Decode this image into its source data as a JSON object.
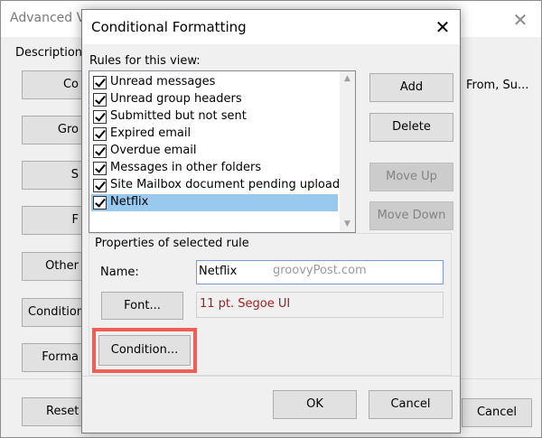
{
  "background_dialog": {
    "title": "Advanced V",
    "description_label": "Description",
    "buttons": [
      "Co",
      "Gro",
      "S",
      "F",
      "Other",
      "Condition",
      "Forma"
    ],
    "from_text": "From, Su...",
    "reset_label": "Reset C",
    "cancel_label": "Cancel",
    "close_glyph": "✕"
  },
  "dialog": {
    "title": "Conditional Formatting",
    "close_glyph": "✕",
    "rules_label": "Rules for this view:",
    "rules": [
      {
        "label": "Unread messages",
        "checked": true,
        "selected": false
      },
      {
        "label": "Unread group headers",
        "checked": true,
        "selected": false
      },
      {
        "label": "Submitted but not sent",
        "checked": true,
        "selected": false
      },
      {
        "label": "Expired email",
        "checked": true,
        "selected": false
      },
      {
        "label": "Overdue email",
        "checked": true,
        "selected": false
      },
      {
        "label": "Messages in other folders",
        "checked": true,
        "selected": false
      },
      {
        "label": "Site Mailbox document pending upload",
        "checked": true,
        "selected": false
      },
      {
        "label": "Netflix",
        "checked": true,
        "selected": true
      }
    ],
    "add_label": "Add",
    "delete_label": "Delete",
    "move_up_label": "Move Up",
    "move_down_label": "Move Down",
    "properties_label": "Properties of selected rule",
    "name_label": "Name:",
    "name_value": "Netflix",
    "watermark": "groovyPost.com",
    "font_button_label": "Font...",
    "font_preview": "11 pt. Segoe UI",
    "condition_button_label": "Condition...",
    "ok_label": "OK",
    "cancel_label": "Cancel",
    "scroll_up_glyph": "▲",
    "scroll_down_glyph": "▼"
  },
  "colors": {
    "selection": "#99c9ef",
    "highlight": "#ef5f55",
    "font_preview_text": "#a32020"
  }
}
